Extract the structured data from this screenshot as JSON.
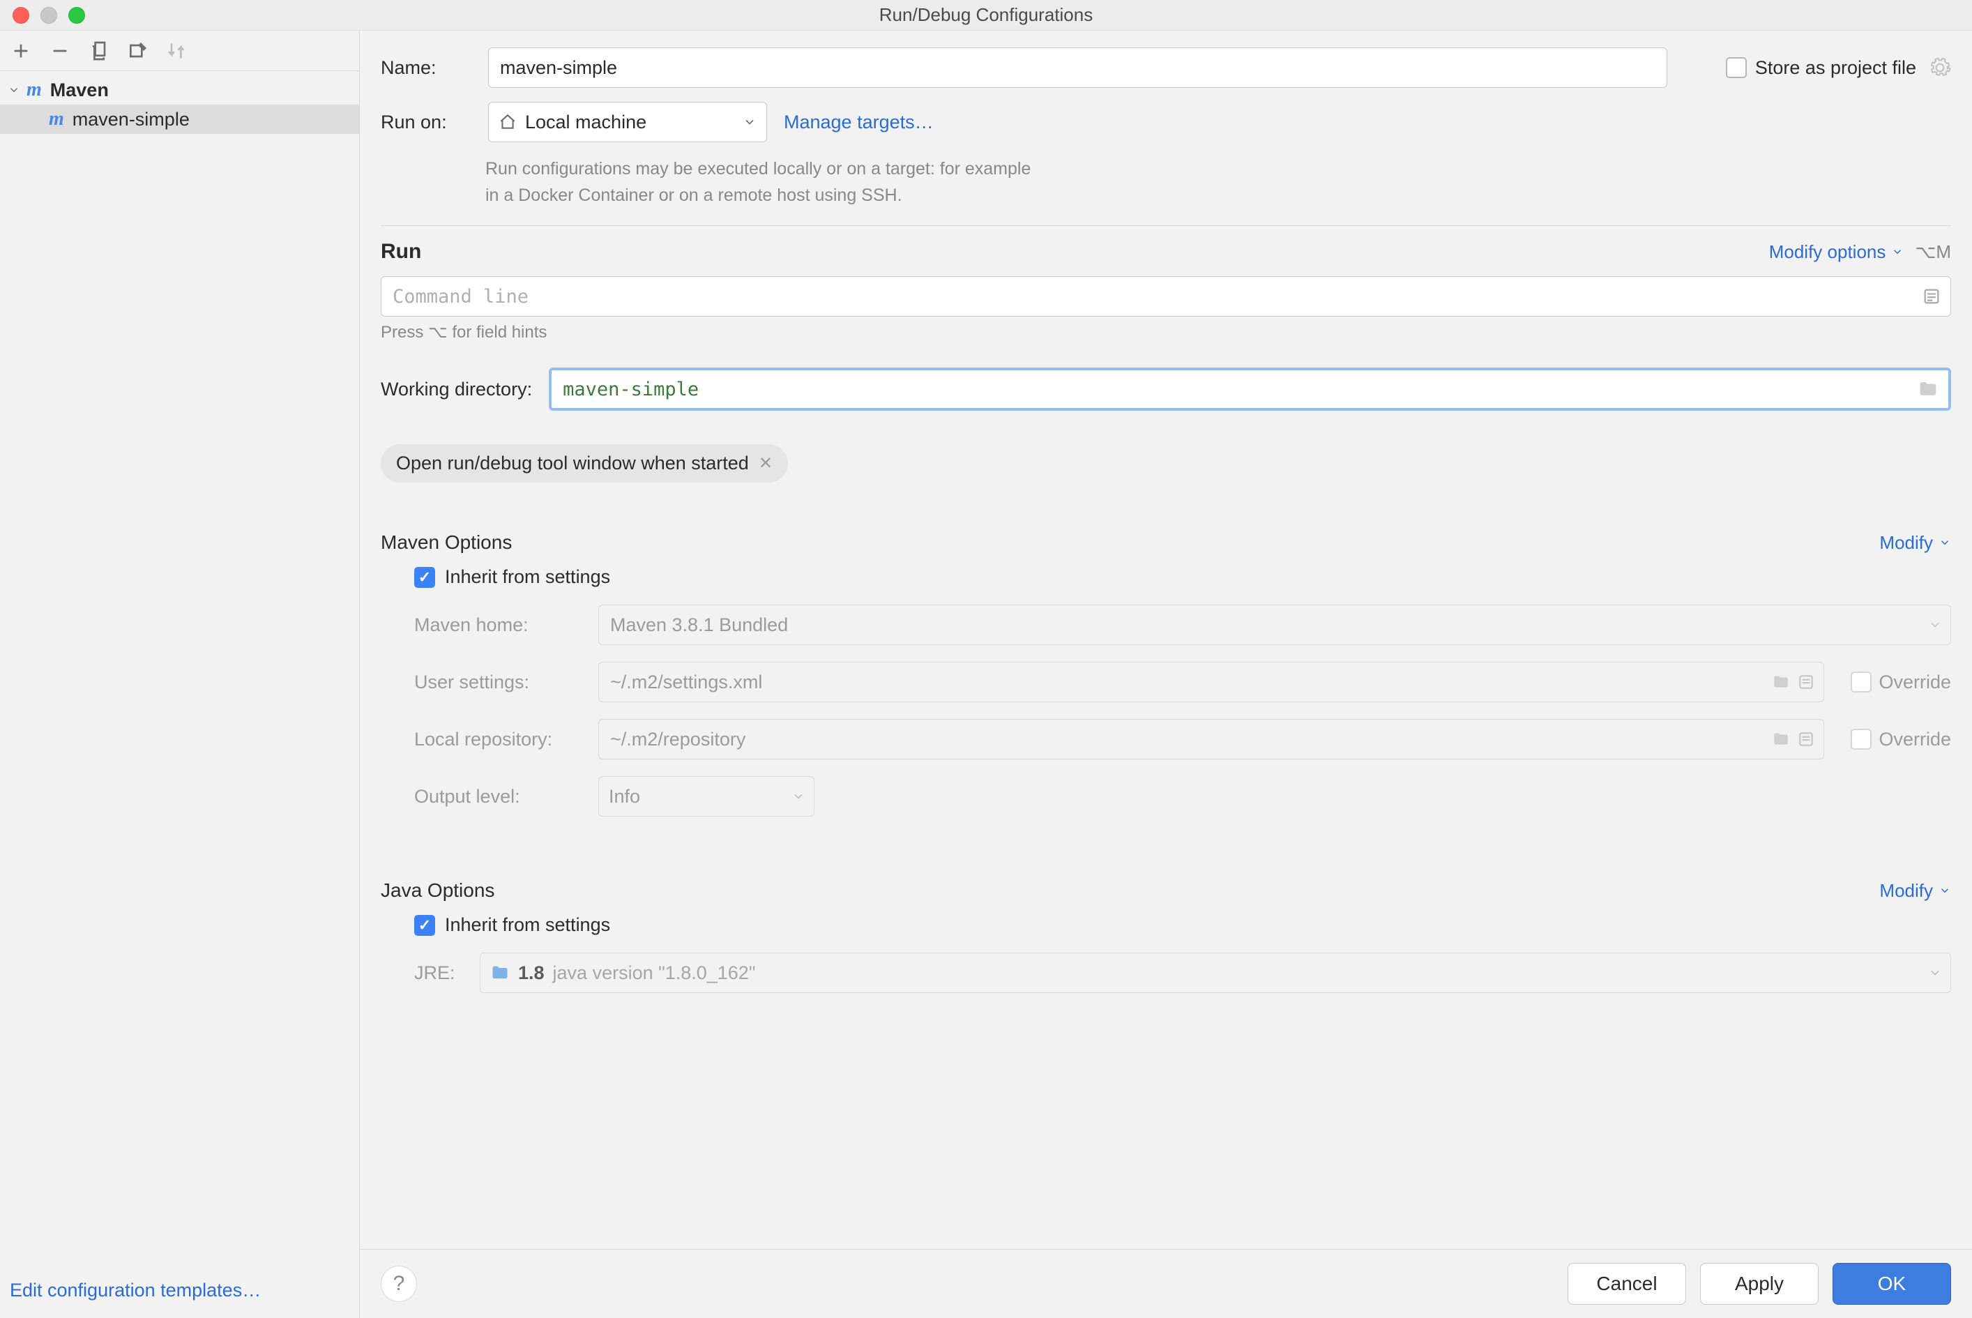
{
  "window": {
    "title": "Run/Debug Configurations"
  },
  "sidebar": {
    "group": "Maven",
    "items": [
      "maven-simple"
    ],
    "edit_templates": "Edit configuration templates…"
  },
  "form": {
    "name_label": "Name:",
    "name_value": "maven-simple",
    "store_as_project": "Store as project file",
    "run_on_label": "Run on:",
    "run_on_value": "Local machine",
    "manage_targets": "Manage targets…",
    "run_on_hint_l1": "Run configurations may be executed locally or on a target: for example",
    "run_on_hint_l2": "in a Docker Container or on a remote host using SSH."
  },
  "run": {
    "title": "Run",
    "modify": "Modify options",
    "shortcut": "⌥M",
    "cmd_placeholder": "Command line",
    "hint": "Press ⌥ for field hints",
    "working_dir_label": "Working directory:",
    "working_dir_value": "maven-simple",
    "chip": "Open run/debug tool window when started"
  },
  "maven": {
    "title": "Maven Options",
    "modify": "Modify",
    "inherit": "Inherit from settings",
    "home_label": "Maven home:",
    "home_value": "Maven 3.8.1 Bundled",
    "user_settings_label": "User settings:",
    "user_settings_value": "~/.m2/settings.xml",
    "local_repo_label": "Local repository:",
    "local_repo_value": "~/.m2/repository",
    "output_label": "Output level:",
    "output_value": "Info",
    "override": "Override"
  },
  "java": {
    "title": "Java Options",
    "modify": "Modify",
    "inherit": "Inherit from settings",
    "jre_label": "JRE:",
    "jre_ver": "1.8",
    "jre_desc": "java version \"1.8.0_162\""
  },
  "footer": {
    "cancel": "Cancel",
    "apply": "Apply",
    "ok": "OK"
  }
}
